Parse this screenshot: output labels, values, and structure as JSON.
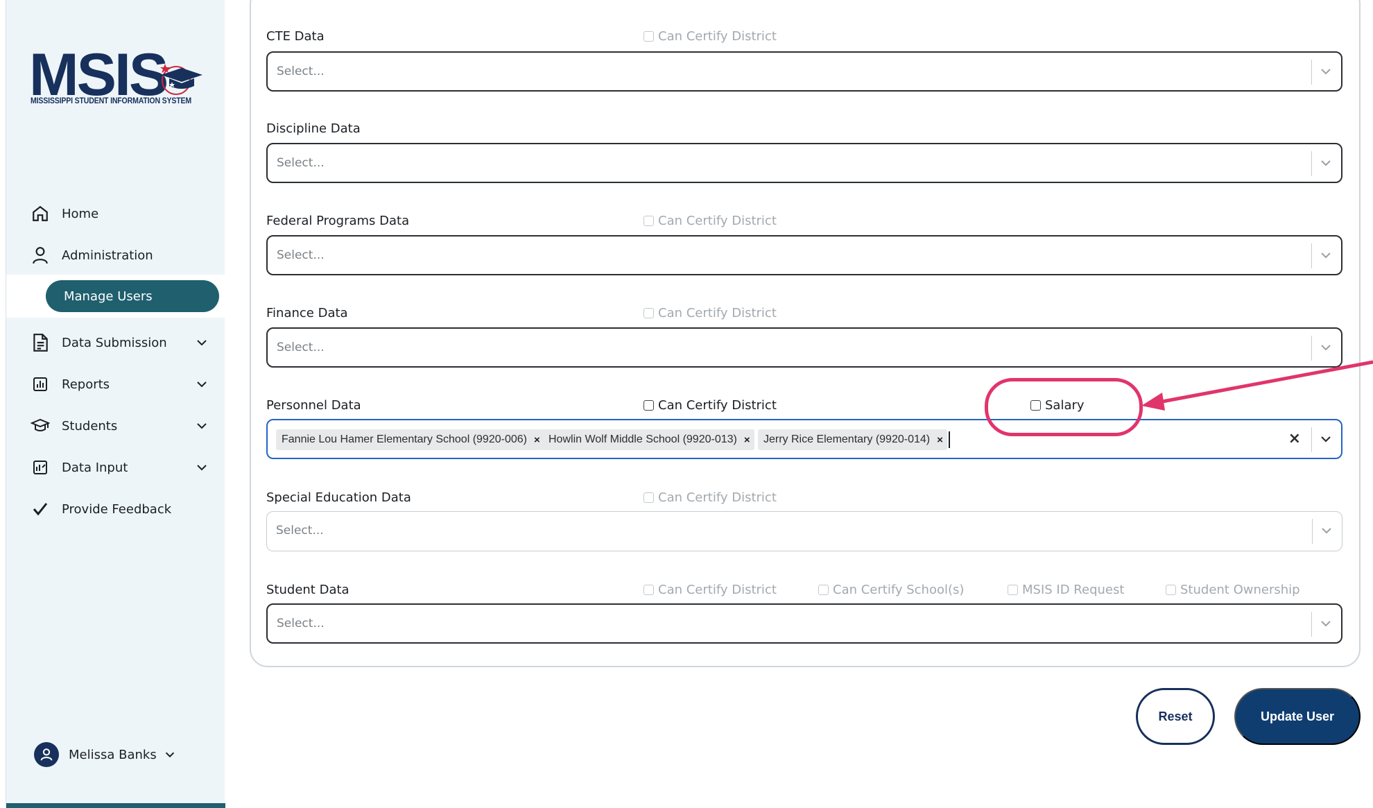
{
  "app": {
    "logo_text": "MSIS",
    "logo_subtitle": "MISSISSIPPI STUDENT INFORMATION SYSTEM"
  },
  "sidebar": {
    "items": [
      {
        "label": "Home",
        "icon": "home-icon"
      },
      {
        "label": "Administration",
        "icon": "user-icon"
      },
      {
        "label": "Manage Users"
      },
      {
        "label": "Data Submission",
        "icon": "document-icon"
      },
      {
        "label": "Reports",
        "icon": "bar-chart-icon"
      },
      {
        "label": "Students",
        "icon": "graduation-cap-icon"
      },
      {
        "label": "Data Input",
        "icon": "data-input-icon"
      },
      {
        "label": "Provide Feedback",
        "icon": "checkmark-icon"
      }
    ],
    "user_name": "Melissa Banks"
  },
  "form": {
    "placeholder": "Select...",
    "can_certify_district": "Can Certify District",
    "can_certify_schools": "Can Certify School(s)",
    "msis_id_request": "MSIS ID Request",
    "student_ownership": "Student Ownership",
    "salary": "Salary",
    "fields": {
      "cte": "CTE Data",
      "discipline": "Discipline Data",
      "federal": "Federal Programs Data",
      "finance": "Finance Data",
      "personnel": "Personnel Data",
      "special_ed": "Special Education Data",
      "student": "Student Data"
    },
    "personnel_selected": [
      "Fannie Lou Hamer Elementary School (9920-006)",
      "Howlin Wolf Middle School (9920-013)",
      "Jerry Rice Elementary (9920-014)"
    ]
  },
  "actions": {
    "reset": "Reset",
    "update": "Update User"
  },
  "colors": {
    "brand_navy": "#17305c",
    "accent_teal": "#1f5f6e",
    "primary_button": "#0f3d70",
    "focus_blue": "#2563c9",
    "annotation_pink": "#e0356b"
  }
}
